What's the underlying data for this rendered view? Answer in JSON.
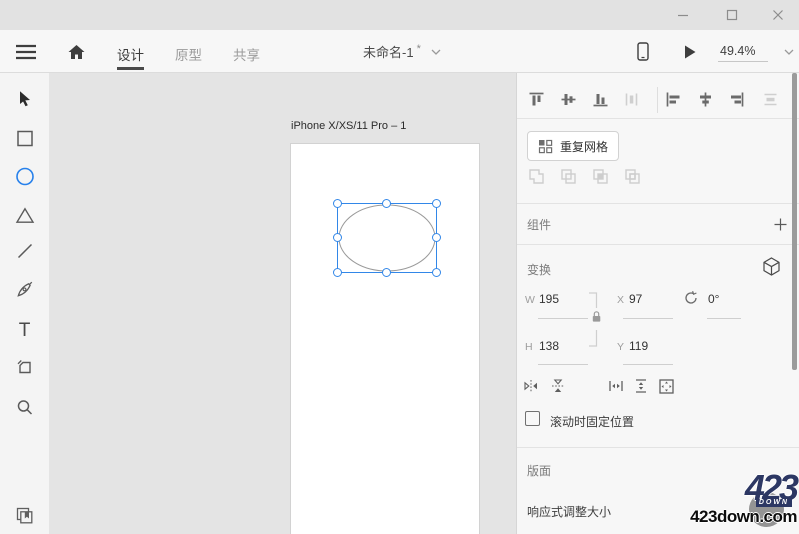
{
  "menubar": {
    "tabs": [
      {
        "label": "设计",
        "active": true
      },
      {
        "label": "原型",
        "active": false
      },
      {
        "label": "共享",
        "active": false
      }
    ],
    "document_title": "未命名-1",
    "unsaved_marker": "*",
    "zoom_value": "49.4%"
  },
  "canvas": {
    "artboard_label": "iPhone X/XS/11 Pro – 1"
  },
  "inspector": {
    "repeat_grid_label": "重复网格",
    "component_title": "组件",
    "transform_title": "变换",
    "fields": {
      "w_label": "W",
      "w_value": "195",
      "x_label": "X",
      "x_value": "97",
      "h_label": "H",
      "h_value": "138",
      "y_label": "Y",
      "y_value": "119",
      "rotation_value": "0°"
    },
    "fix_on_scroll_label": "滚动时固定位置",
    "layout_title": "版面",
    "responsive_resize_label": "响应式调整大小"
  },
  "watermark": {
    "brand": "423",
    "brand_sub": "DOWN",
    "site": "423down.com"
  },
  "colors": {
    "accent_blue": "#2680EB",
    "selection_stroke": "#3287E8",
    "watermark_navy": "#2C3763"
  }
}
